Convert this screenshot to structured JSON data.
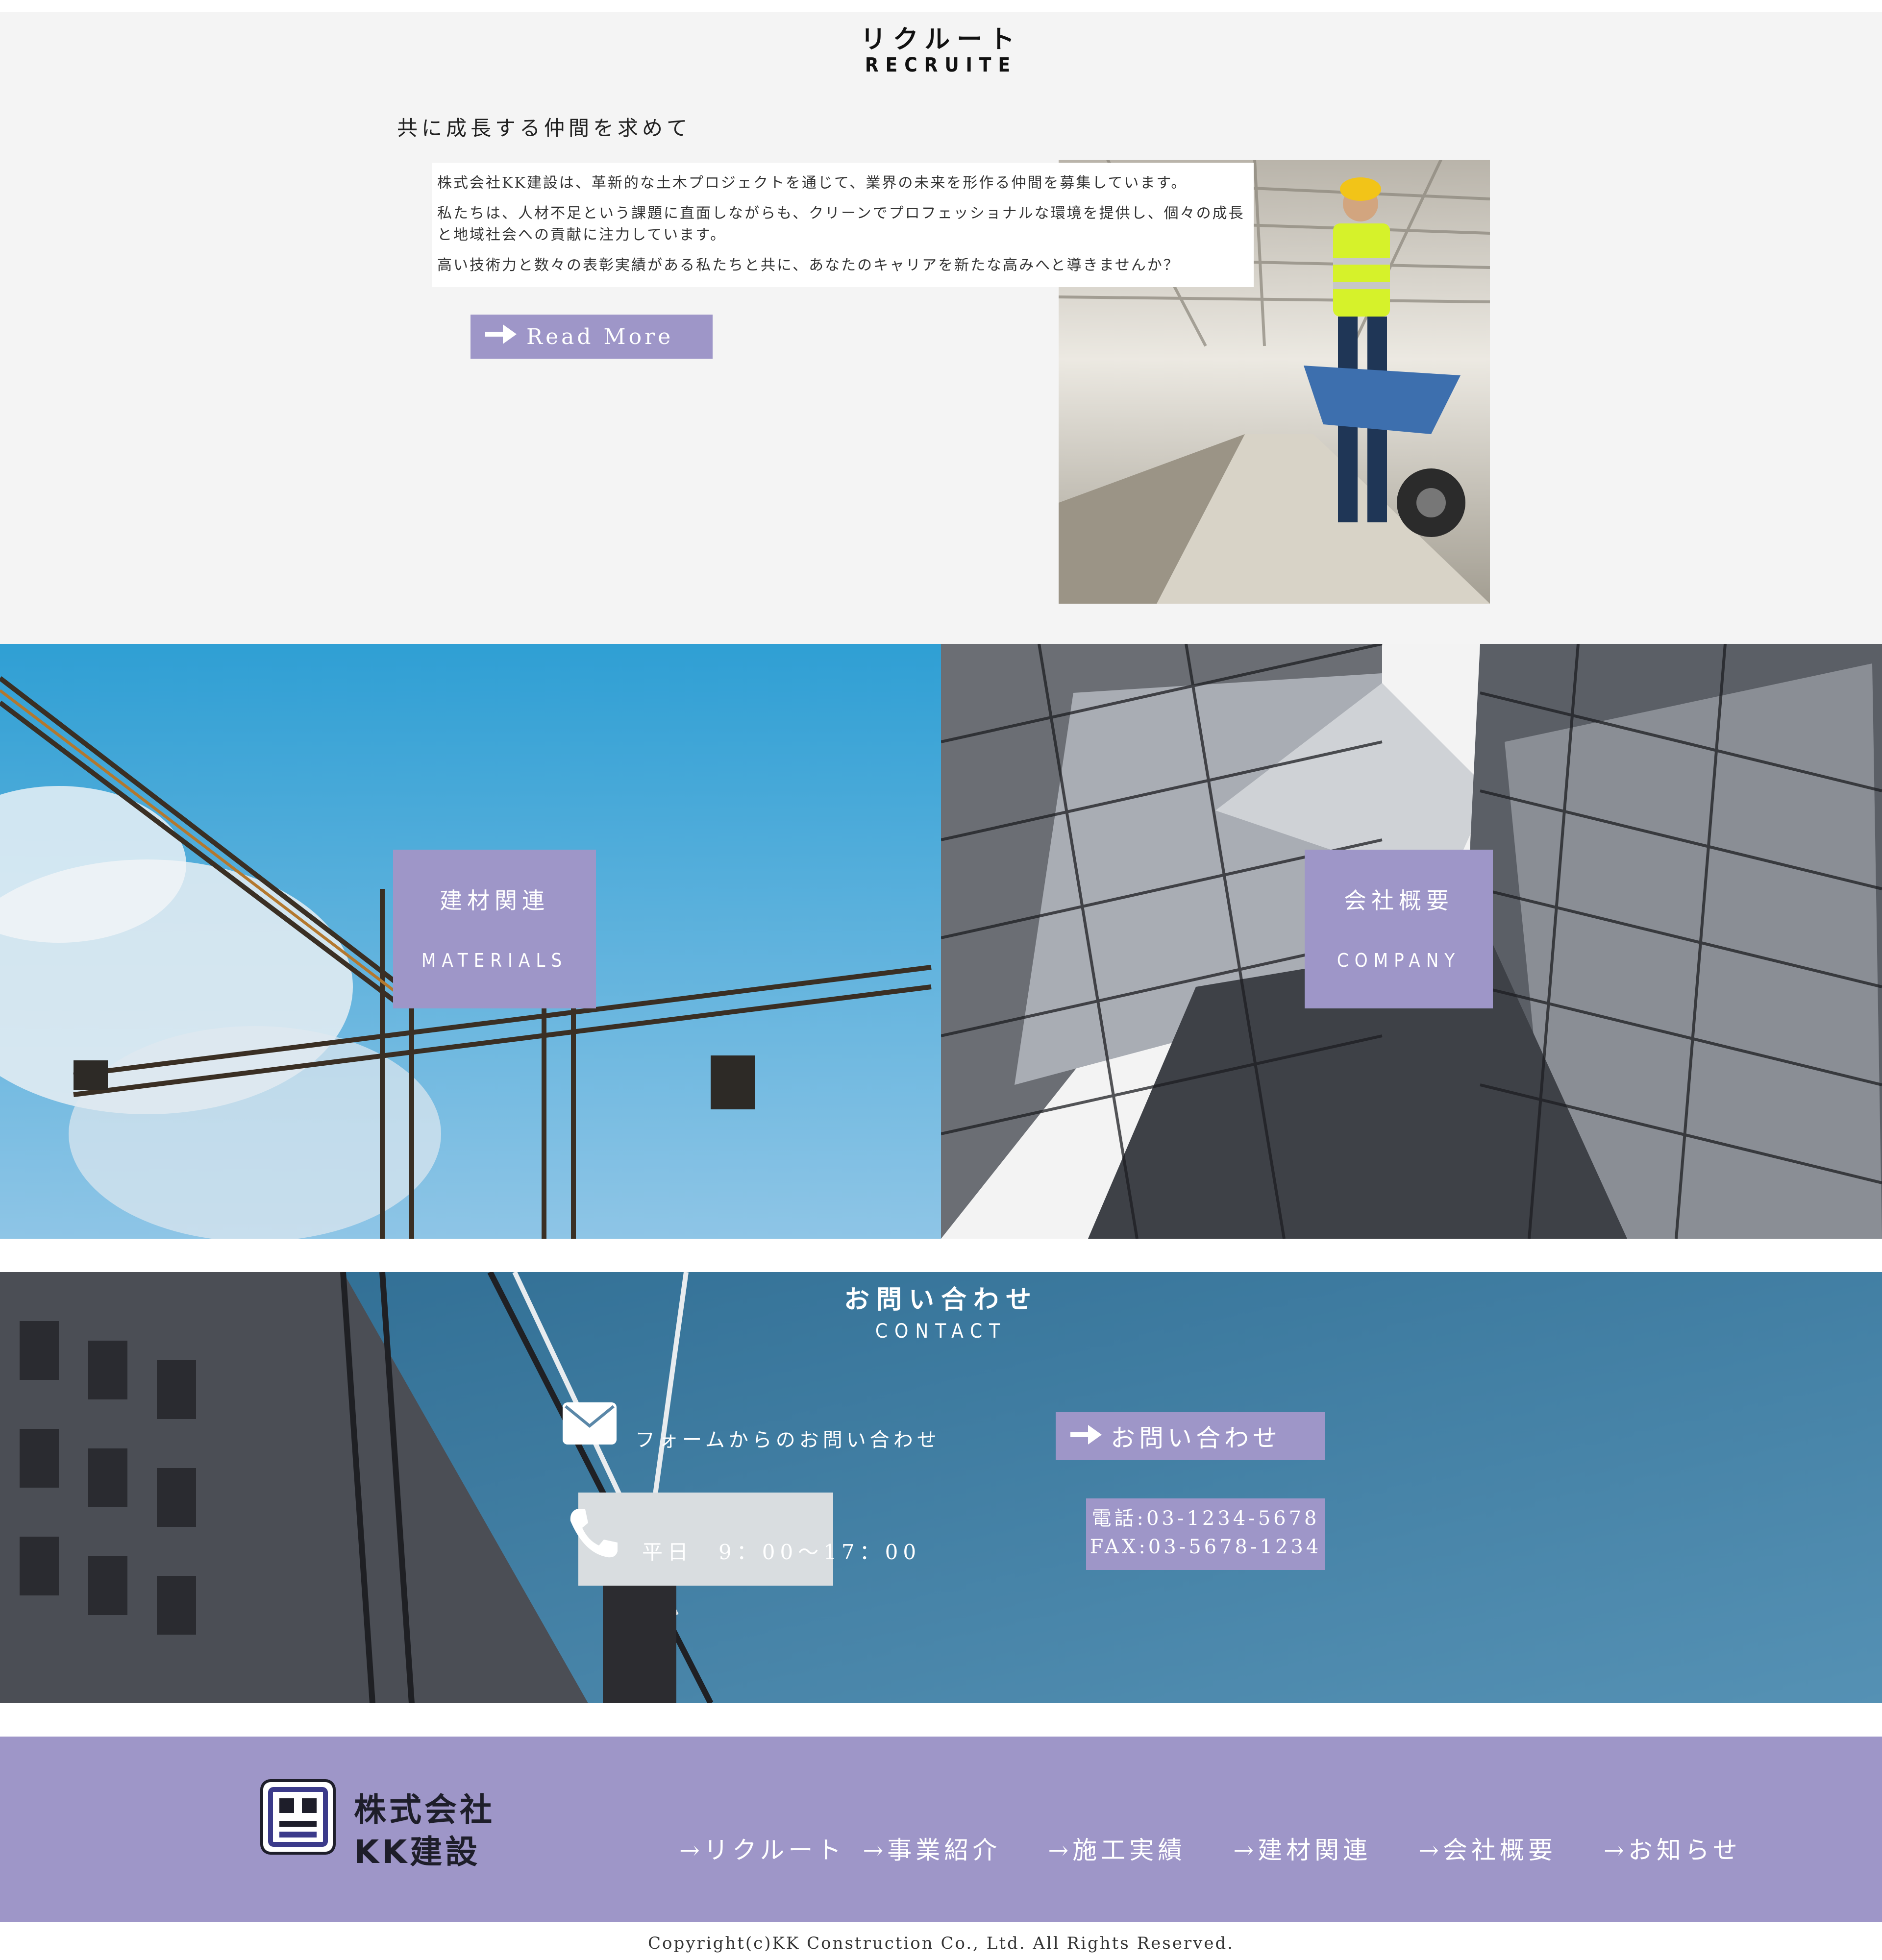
{
  "recruit": {
    "title": "リクルート",
    "subtitle": "RECRUITE",
    "lead": "共に成長する仲間を求めて",
    "paragraphs": [
      "株式会社KK建設は、革新的な土木プロジェクトを通じて、業界の未来を形作る仲間を募集しています。",
      "私たちは、人材不足という課題に直面しながらも、クリーンでプロフェッショナルな環境を提供し、個々の成長と地域社会への貢献に注力しています。",
      "高い技術力と数々の表彰実績がある私たちと共に、あなたのキャリアを新たな高みへと導きませんか？"
    ],
    "read_more": "Read More"
  },
  "tiles": {
    "materials": {
      "jp": "建材関連",
      "en": "MATERIALS"
    },
    "company": {
      "jp": "会社概要",
      "en": "COMPANY"
    }
  },
  "contact": {
    "title": "お問い合わせ",
    "subtitle": "CONTACT",
    "form_label": "フォームからのお問い合わせ",
    "hours": "平日　9：00～17：00",
    "button": "お問い合わせ",
    "phone": "電話:03-1234-5678",
    "fax": "FAX:03-5678-1234"
  },
  "footer": {
    "logo_line1": "株式会社",
    "logo_line2": "KK建設",
    "nav": [
      "→リクルート",
      "→事業紹介",
      "→施工実績",
      "→建材関連",
      "→会社概要",
      "→お知らせ"
    ],
    "copyright": "Copyright(c)KK Construction Co., Ltd. All Rights Reserved."
  },
  "colors": {
    "accent": "#9e96c8",
    "section_bg": "#f4f4f4"
  }
}
